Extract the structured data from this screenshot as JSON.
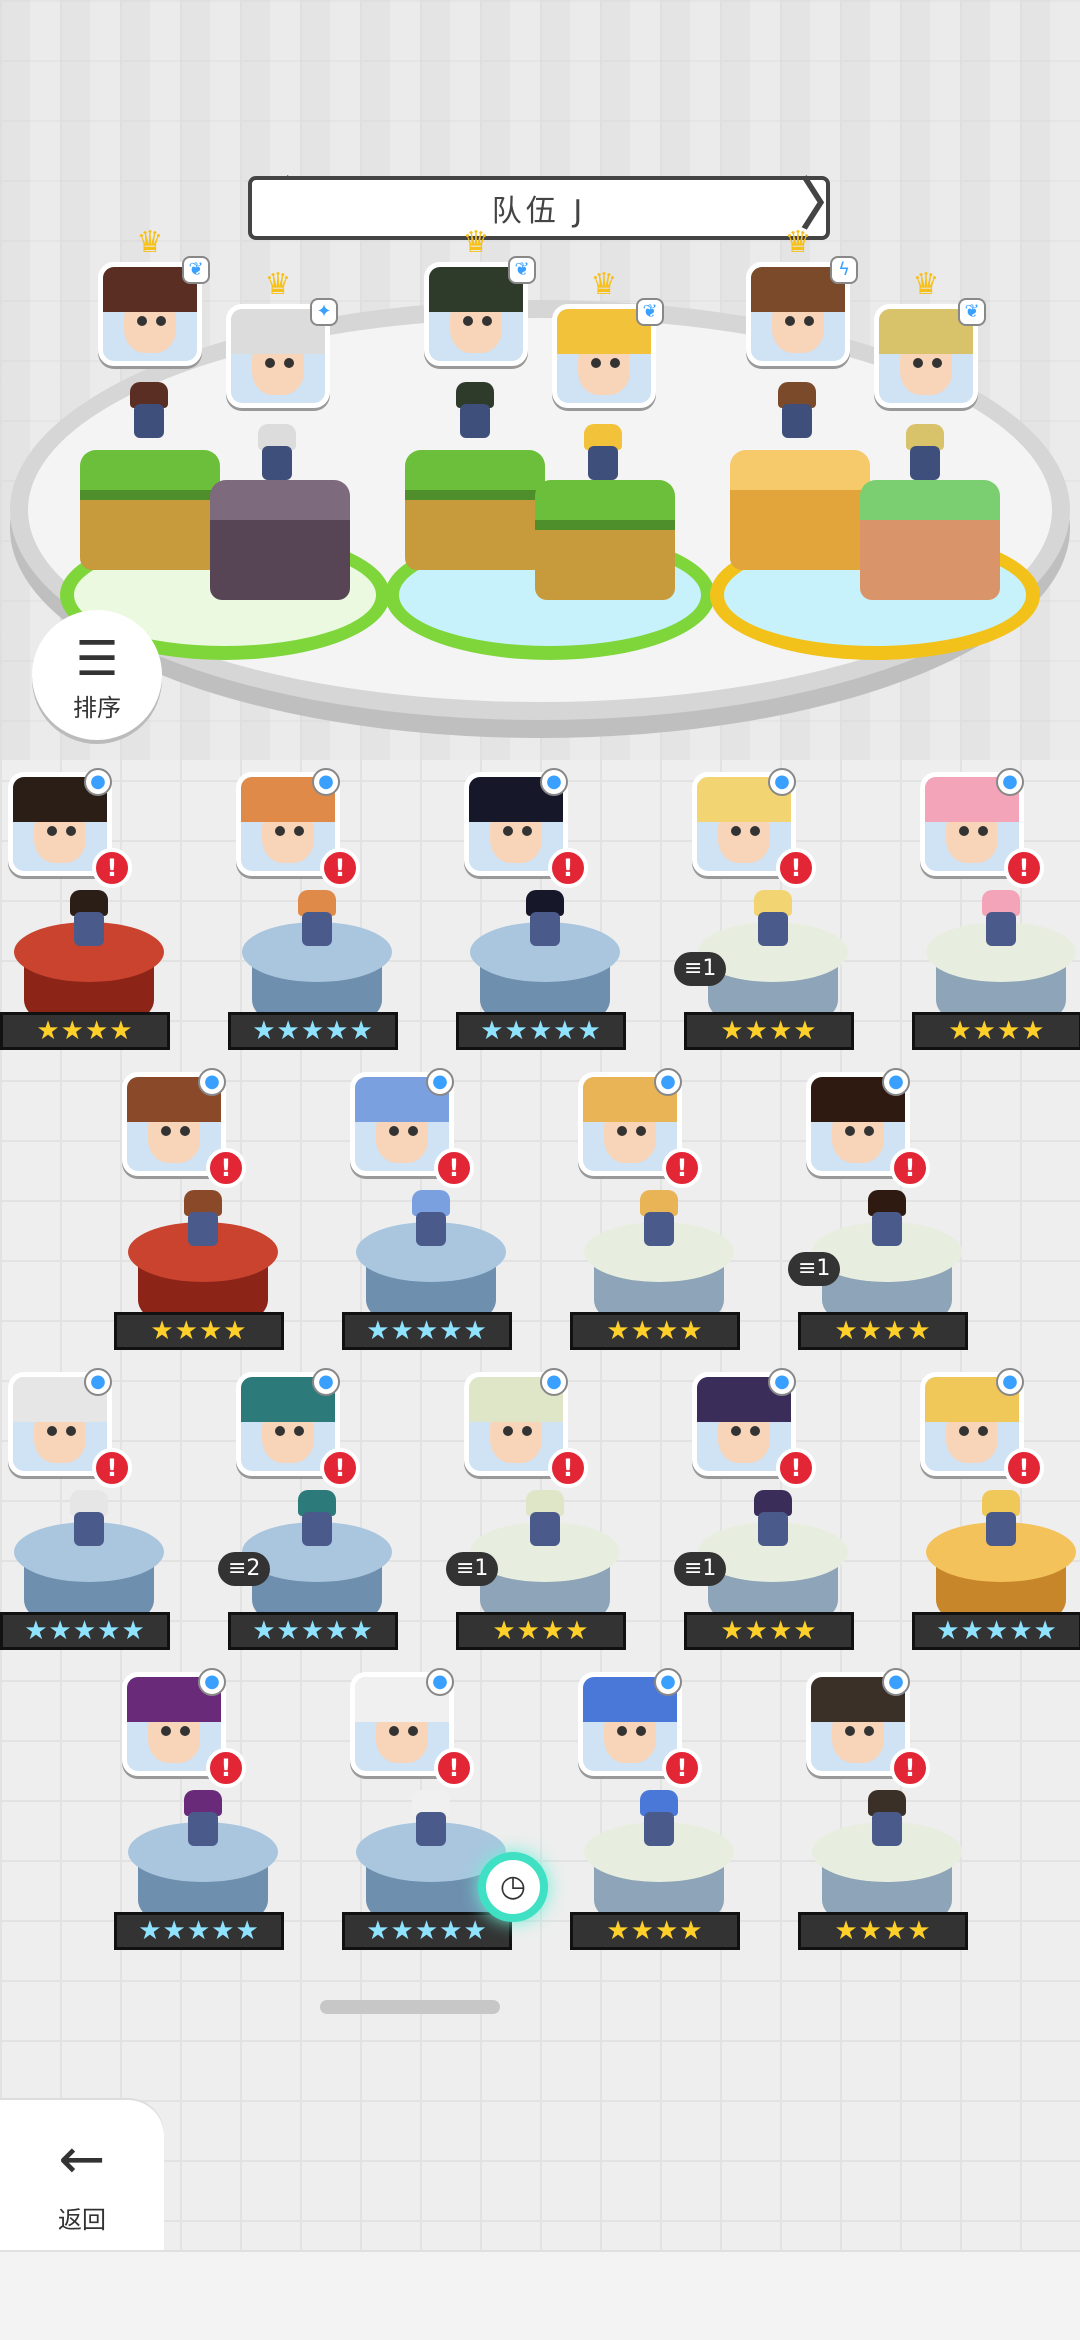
{
  "header": {
    "team_title": "队伍 J",
    "prev_arrow": "〈",
    "next_arrow": "〉"
  },
  "sort_button": {
    "label": "排序",
    "icon": "sort-lines-icon"
  },
  "back_button": {
    "label": "返回",
    "icon": "back-arrow-icon"
  },
  "team_members": [
    {
      "hair": "#5a2e22",
      "crown": true,
      "element": "leaf"
    },
    {
      "hair": "#dcdcdc",
      "crown": true,
      "element": "sparkle"
    },
    {
      "hair": "#2e3b2a",
      "crown": true,
      "element": "leaf"
    },
    {
      "hair": "#f2c23a",
      "crown": true,
      "element": "leaf"
    },
    {
      "hair": "#7a4a2a",
      "crown": true,
      "element": "bolt"
    },
    {
      "hair": "#d8c26a",
      "crown": true,
      "element": "leaf"
    }
  ],
  "roster": [
    {
      "stars": "★★★★",
      "alert": "!",
      "dup": ""
    },
    {
      "stars": "★★★★★",
      "alert": "!",
      "dup": ""
    },
    {
      "stars": "★★★★★",
      "alert": "!",
      "dup": ""
    },
    {
      "stars": "★★★★",
      "alert": "!",
      "dup": "1"
    },
    {
      "stars": "★★★★",
      "alert": "!",
      "dup": ""
    },
    {
      "stars": "★★★★",
      "alert": "!",
      "dup": ""
    },
    {
      "stars": "★★★★★",
      "alert": "!",
      "dup": ""
    },
    {
      "stars": "★★★★",
      "alert": "!",
      "dup": ""
    },
    {
      "stars": "★★★★",
      "alert": "!",
      "dup": "1"
    },
    {
      "stars": "★★★★★",
      "alert": "!",
      "dup": ""
    },
    {
      "stars": "★★★★★",
      "alert": "!",
      "dup": "2"
    },
    {
      "stars": "★★★★",
      "alert": "!",
      "dup": "1"
    },
    {
      "stars": "★★★★",
      "alert": "!",
      "dup": "1"
    },
    {
      "stars": "★★★★★",
      "alert": "!",
      "dup": ""
    },
    {
      "stars": "★★★★★",
      "alert": "!",
      "dup": ""
    },
    {
      "stars": "★★★★★",
      "alert": "!",
      "dup": ""
    },
    {
      "stars": "★★★★",
      "alert": "!",
      "dup": ""
    },
    {
      "stars": "★★★★",
      "alert": "!",
      "dup": ""
    }
  ]
}
